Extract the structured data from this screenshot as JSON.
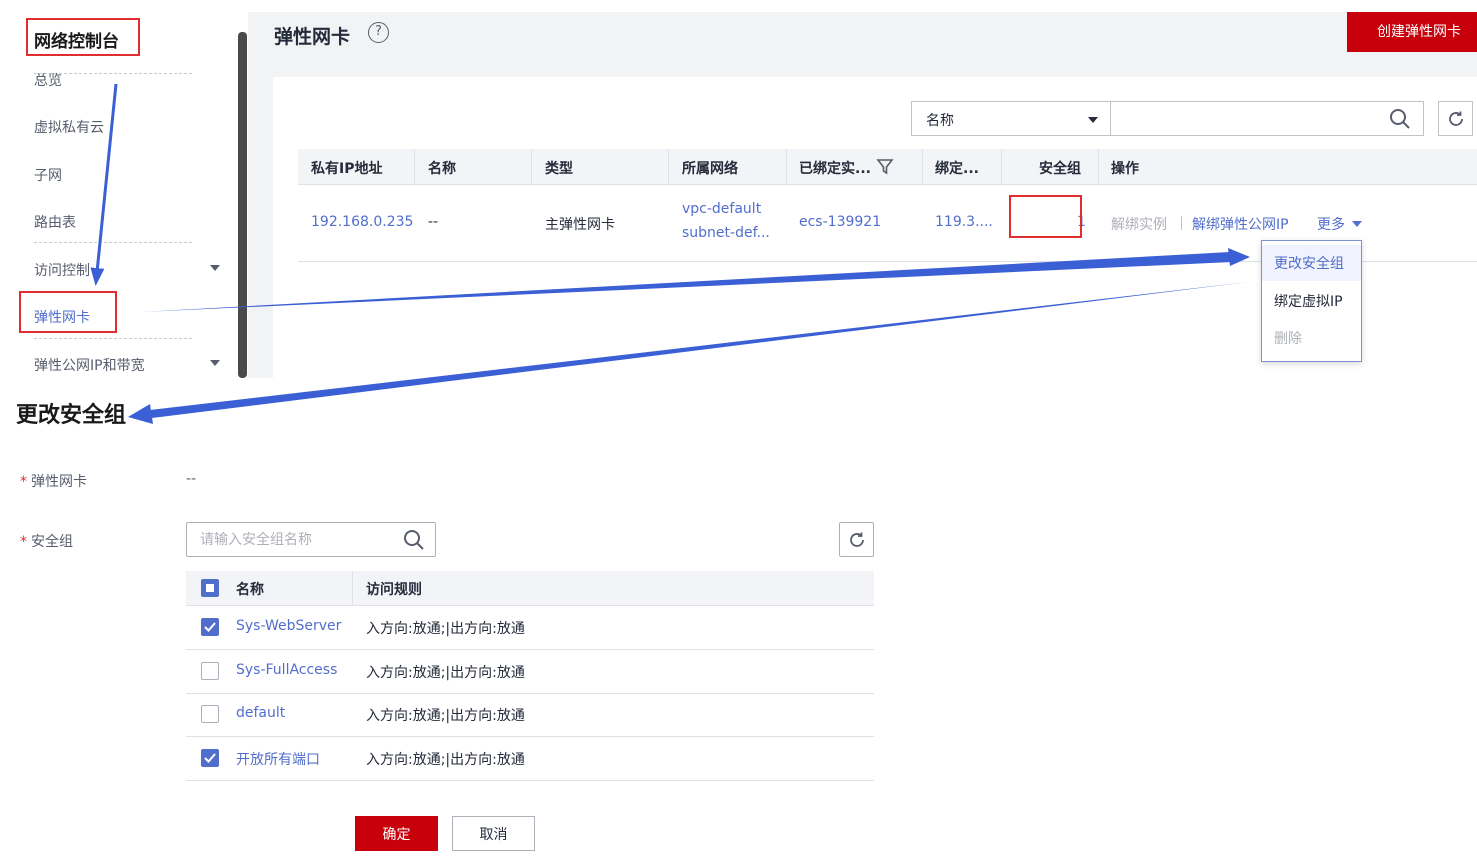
{
  "console": {
    "title": "网络控制台",
    "nav_items": [
      {
        "label": "总览"
      },
      {
        "label": "虚拟私有云"
      },
      {
        "label": "子网"
      },
      {
        "label": "路由表"
      },
      {
        "label": "访问控制"
      },
      {
        "label": "弹性网卡"
      },
      {
        "label": "弹性公网IP和带宽"
      }
    ],
    "active_item": "弹性网卡"
  },
  "page": {
    "title": "弹性网卡",
    "create_button": "创建弹性网卡",
    "help_icon": "?"
  },
  "filter": {
    "select_value": "名称",
    "input_value": ""
  },
  "table": {
    "headers": [
      "私有IP地址",
      "名称",
      "类型",
      "所属网络",
      "已绑定实...",
      "绑定...",
      "安全组",
      "操作"
    ],
    "rows": [
      {
        "private_ip": "192.168.0.235",
        "name": "--",
        "type": "主弹性网卡",
        "network_vpc": "vpc-default",
        "network_subnet": "subnet-def...",
        "bound_instance": "ecs-139921",
        "bound_ip": "119.3....",
        "security_group_count": "1",
        "actions": [
          "解绑实例",
          "解绑弹性公网IP",
          "更多"
        ]
      }
    ]
  },
  "more_menu": {
    "items": [
      "更改安全组",
      "绑定虚拟IP",
      "删除"
    ],
    "hover_item": "更改安全组",
    "disabled_item": "删除"
  },
  "dialog": {
    "title": "更改安全组",
    "eni_label": "弹性网卡",
    "eni_value": "--",
    "sg_label": "安全组",
    "required_mark": "*",
    "search_placeholder": "请输入安全组名称",
    "columns": [
      "名称",
      "访问规则"
    ],
    "groups": [
      {
        "name": "Sys-WebServer",
        "rule": "入方向:放通;|出方向:放通",
        "checked": true
      },
      {
        "name": "Sys-FullAccess",
        "rule": "入方向:放通;|出方向:放通",
        "checked": false
      },
      {
        "name": "default",
        "rule": "入方向:放通;|出方向:放通",
        "checked": false
      },
      {
        "name": "开放所有端口",
        "rule": "入方向:放通;|出方向:放通",
        "checked": true
      }
    ],
    "ok_label": "确定",
    "cancel_label": "取消"
  },
  "colors": {
    "brand_red": "#c7000b",
    "link_blue": "#526ecc",
    "annotation_red": "#e02d2d",
    "annotation_arrow": "#3b5fd4"
  }
}
